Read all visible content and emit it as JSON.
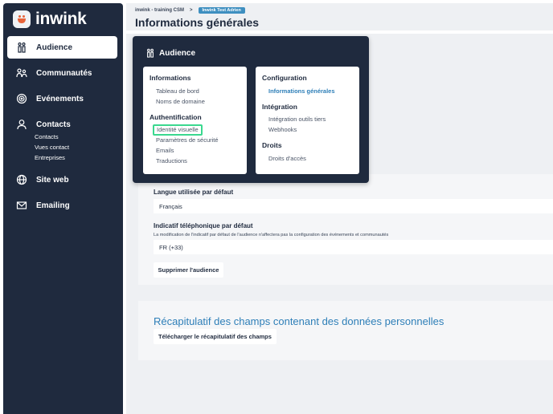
{
  "app": {
    "name": "inwink"
  },
  "sidebar": {
    "items": [
      {
        "label": "Audience",
        "icon": "audience-icon",
        "active": true
      },
      {
        "label": "Communautés",
        "icon": "communities-icon"
      },
      {
        "label": "Evénements",
        "icon": "events-icon"
      },
      {
        "label": "Contacts",
        "icon": "person-icon",
        "subitems": [
          "Contacts",
          "Vues contact",
          "Entreprises"
        ]
      },
      {
        "label": "Site web",
        "icon": "globe-icon"
      },
      {
        "label": "Emailing",
        "icon": "mail-icon"
      }
    ]
  },
  "header": {
    "breadcrumb": [
      "inwink - training CSM",
      "Inwink Test Adrien"
    ],
    "breadcrumb_separator": ">",
    "title": "Informations générales"
  },
  "dropdown": {
    "title": "Audience",
    "left_panel": {
      "sections": [
        {
          "heading": "Informations",
          "links": [
            "Tableau de bord",
            "Noms de domaine"
          ]
        },
        {
          "heading": "Authentification",
          "links": [
            "Identité visuelle",
            "Paramètres de sécurité",
            "Emails",
            "Traductions"
          ]
        }
      ]
    },
    "right_panel": {
      "sections": [
        {
          "heading": "Configuration",
          "links": [
            "Informations générales"
          ]
        },
        {
          "heading": "Intégration",
          "links": [
            "Intégration outils tiers",
            "Webhooks"
          ]
        },
        {
          "heading": "Droits",
          "links": [
            "Droits d'accès"
          ]
        }
      ]
    }
  },
  "form": {
    "language_label": "Langue utilisée par défaut",
    "language_value": "Français",
    "phone_label": "Indicatif téléphonique par défaut",
    "phone_help": "La modification de l'indicatif par défaut de l'audience n'affectera pas la configuration des événements et communautés",
    "phone_value": "FR (+33)",
    "delete_button": "Supprimer l'audience"
  },
  "recap": {
    "title": "Récapitulatif des champs contenant des données personnelles",
    "download_button": "Télécharger le récapitulatif des champs"
  },
  "colors": {
    "sidebar": "#1f2a3e",
    "accent": "#2e7fb8",
    "highlight": "#3ad88f",
    "brand": "#e8643a"
  }
}
